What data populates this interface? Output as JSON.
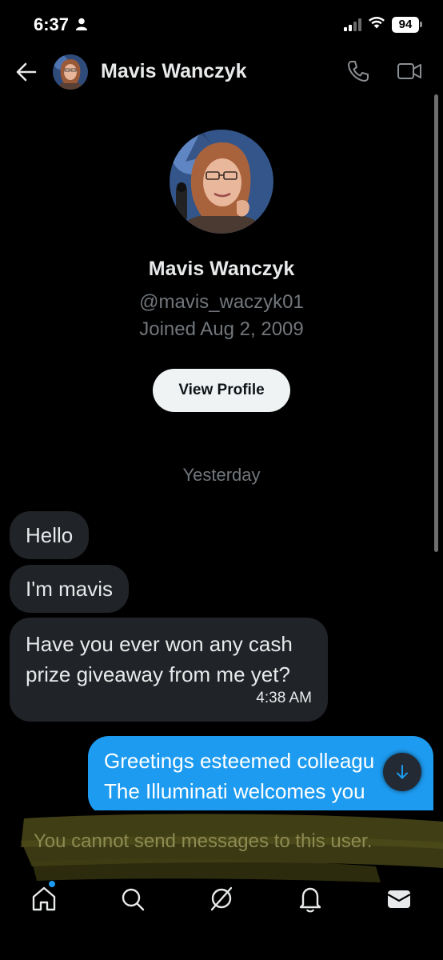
{
  "status_bar": {
    "time": "6:37",
    "battery": "94"
  },
  "header": {
    "contact_name": "Mavis Wanczyk"
  },
  "profile": {
    "name": "Mavis Wanczyk",
    "handle": "@mavis_waczyk01",
    "joined": "Joined Aug 2, 2009",
    "view_profile_label": "View Profile"
  },
  "conversation": {
    "date_divider": "Yesterday",
    "incoming": [
      {
        "text": "Hello"
      },
      {
        "text": "I'm mavis"
      },
      {
        "text": "Have you ever won any cash prize giveaway from me yet?",
        "time": "4:38 AM"
      }
    ],
    "outgoing": {
      "line1": "Greetings esteemed colleagu",
      "line2": "The Illuminati welcomes you"
    }
  },
  "notice": {
    "text": "You cannot send messages to this user."
  },
  "colors": {
    "background": "#000000",
    "incoming_bubble": "#202327",
    "outgoing_bubble": "#1d9bf0",
    "secondary_text": "#71767b",
    "notice_text": "#8d8b52",
    "highlight": "#5d5a1f"
  },
  "tabs": [
    {
      "icon": "home-icon",
      "badge": true
    },
    {
      "icon": "search-icon"
    },
    {
      "icon": "grok-icon"
    },
    {
      "icon": "bell-icon"
    },
    {
      "icon": "envelope-icon",
      "active": true
    }
  ]
}
